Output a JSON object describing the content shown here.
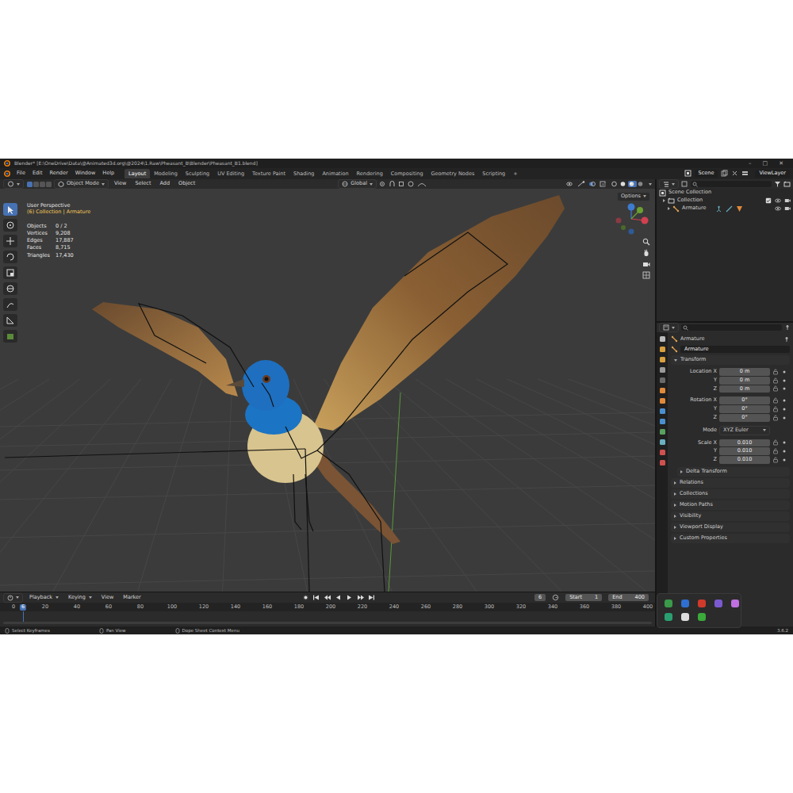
{
  "window": {
    "title": "Blender* [E:\\OneDrive\\Data\\@Animated3d.org\\@2024\\1.Raw\\Pheasant_B\\Blender\\Pheasant_B1.blend]",
    "controls": [
      "–",
      "□",
      "✕"
    ]
  },
  "menu": [
    "File",
    "Edit",
    "Render",
    "Window",
    "Help"
  ],
  "workspaces": [
    {
      "label": "Layout",
      "selected": true
    },
    {
      "label": "Modeling",
      "selected": false
    },
    {
      "label": "Sculpting",
      "selected": false
    },
    {
      "label": "UV Editing",
      "selected": false
    },
    {
      "label": "Texture Paint",
      "selected": false
    },
    {
      "label": "Shading",
      "selected": false
    },
    {
      "label": "Animation",
      "selected": false
    },
    {
      "label": "Rendering",
      "selected": false
    },
    {
      "label": "Compositing",
      "selected": false
    },
    {
      "label": "Geometry Nodes",
      "selected": false
    },
    {
      "label": "Scripting",
      "selected": false
    }
  ],
  "add_workspace": "+",
  "scene": "Scene",
  "view_layer": "ViewLayer",
  "viewport_header": {
    "mode": "Object Mode",
    "menus": [
      "View",
      "Select",
      "Add",
      "Object"
    ],
    "orientation": "Global",
    "shading": [
      {
        "selected": false
      },
      {
        "selected": false
      },
      {
        "selected": true
      },
      {
        "selected": false
      }
    ]
  },
  "toolbar": {
    "tools": [
      {
        "selected": true
      },
      {
        "selected": false
      },
      {
        "selected": false
      },
      {
        "selected": false
      },
      {
        "selected": false
      },
      {
        "selected": false
      },
      {
        "selected": false
      },
      {
        "selected": false
      },
      {
        "selected": false
      }
    ]
  },
  "viewport": {
    "view_name": "User Perspective",
    "context": "(6) Collection | Armature",
    "options": "Options",
    "stats": [
      {
        "label": "Objects",
        "value": "0 / 2"
      },
      {
        "label": "Vertices",
        "value": "9,208"
      },
      {
        "label": "Edges",
        "value": "17,887"
      },
      {
        "label": "Faces",
        "value": "8,715"
      },
      {
        "label": "Triangles",
        "value": "17,430"
      }
    ]
  },
  "outliner": {
    "items": [
      {
        "label": "Scene Collection",
        "kind": "scene"
      },
      {
        "label": "Collection",
        "kind": "collection"
      },
      {
        "label": "Armature",
        "kind": "object"
      }
    ]
  },
  "properties": {
    "object_name": "Armature",
    "datablock": "Armature",
    "transform_title": "Transform",
    "transform": [
      {
        "label": "Location X",
        "value": "0 m"
      },
      {
        "label": "Y",
        "value": "0 m"
      },
      {
        "label": "Z",
        "value": "0 m"
      },
      {
        "label": "Rotation X",
        "value": "0°"
      },
      {
        "label": "Y",
        "value": "0°"
      },
      {
        "label": "Z",
        "value": "0°"
      }
    ],
    "mode_label": "Mode",
    "mode": "XYZ Euler",
    "scale": [
      {
        "label": "Scale X",
        "value": "0.010"
      },
      {
        "label": "Y",
        "value": "0.010"
      },
      {
        "label": "Z",
        "value": "0.010"
      }
    ],
    "sections": [
      "Delta Transform",
      "Relations",
      "Collections",
      "Motion Paths",
      "Visibility",
      "Viewport Display",
      "Custom Properties"
    ]
  },
  "timeline": {
    "menus": [
      "Playback",
      "Keying",
      "View",
      "Marker"
    ],
    "current_frame": "6",
    "start_label": "Start",
    "start": "1",
    "end_label": "End",
    "end": "400",
    "ticks": [
      {
        "label": "0",
        "selected": false
      },
      {
        "label": "6",
        "selected": true
      },
      {
        "label": "20",
        "selected": false
      },
      {
        "label": "40",
        "selected": false
      },
      {
        "label": "60",
        "selected": false
      },
      {
        "label": "80",
        "selected": false
      },
      {
        "label": "100",
        "selected": false
      },
      {
        "label": "120",
        "selected": false
      },
      {
        "label": "140",
        "selected": false
      },
      {
        "label": "160",
        "selected": false
      },
      {
        "label": "180",
        "selected": false
      },
      {
        "label": "200",
        "selected": false
      },
      {
        "label": "220",
        "selected": false
      },
      {
        "label": "240",
        "selected": false
      },
      {
        "label": "260",
        "selected": false
      },
      {
        "label": "280",
        "selected": false
      },
      {
        "label": "300",
        "selected": false
      },
      {
        "label": "320",
        "selected": false
      },
      {
        "label": "340",
        "selected": false
      },
      {
        "label": "360",
        "selected": false
      },
      {
        "label": "380",
        "selected": false
      },
      {
        "label": "400",
        "selected": false
      }
    ]
  },
  "status_bar": {
    "hints": [
      "Select Keyframes",
      "Pan View",
      "Dope Sheet Context Menu"
    ],
    "version": "3.6.2"
  }
}
